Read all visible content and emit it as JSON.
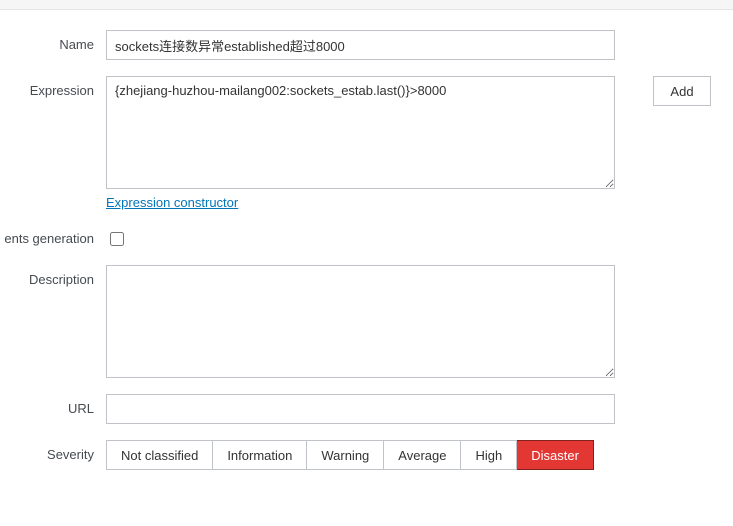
{
  "labels": {
    "name": "Name",
    "expression": "Expression",
    "events_generation": "ents generation",
    "description": "Description",
    "url": "URL",
    "severity": "Severity"
  },
  "fields": {
    "name_value": "sockets连接数异常established超过8000",
    "expression_value": "{zhejiang-huzhou-mailang002:sockets_estab.last()}>8000",
    "description_value": "",
    "url_value": "",
    "events_generation_checked": false
  },
  "buttons": {
    "add": "Add"
  },
  "links": {
    "expression_constructor": "Expression constructor"
  },
  "severity": {
    "options": [
      "Not classified",
      "Information",
      "Warning",
      "Average",
      "High",
      "Disaster"
    ],
    "selected_index": 5
  }
}
